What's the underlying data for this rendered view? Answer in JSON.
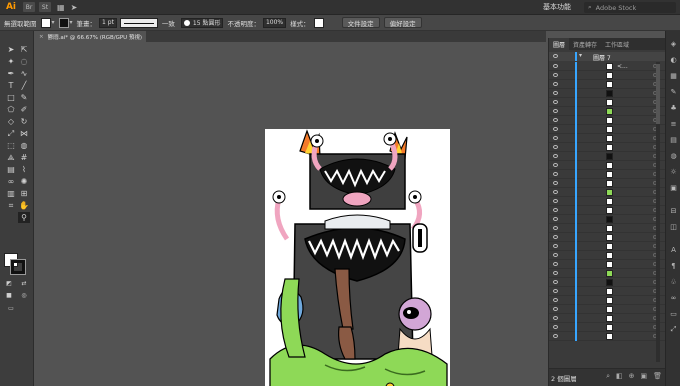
{
  "menubar": {
    "app_icon": "Ai",
    "bridge_chip": "Br",
    "stock_chip": "St",
    "workspace": "基本功能",
    "search_placeholder": "Adobe Stock"
  },
  "controlbar": {
    "selection_state": "無選取範圍",
    "stroke_label": "筆畫：",
    "stroke_weight": "1 pt",
    "stroke_style": "一致",
    "brush": "15 點圓形",
    "opacity_label": "不透明度：",
    "opacity_value": "100%",
    "style_label": "樣式：",
    "doc_setup": "文件設定",
    "preferences": "偏好設定"
  },
  "document_tab": {
    "title": "鬱悶.ai* @ 66.67% (RGB/GPU 預視)",
    "close": "×"
  },
  "layers_panel": {
    "tabs": [
      "圖層",
      "資產轉存",
      "工作區域"
    ],
    "active_tab": 0,
    "top_layer_name": "圖層 7",
    "sub_layer_name": "<...",
    "layer_count": "2 個圖層",
    "row_count": 31
  },
  "icons": {
    "tools": [
      "selection-icon",
      "direct-selection-icon",
      "magic-wand-icon",
      "lasso-icon",
      "pen-icon",
      "curvature-icon",
      "type-icon",
      "line-icon",
      "rectangle-icon",
      "paintbrush-icon",
      "shaper-icon",
      "pencil-icon",
      "eraser-icon",
      "rotate-icon",
      "scale-icon",
      "width-icon",
      "free-transform-icon",
      "shape-builder-icon",
      "perspective-grid-icon",
      "mesh-icon",
      "gradient-icon",
      "eyedropper-icon",
      "blend-icon",
      "symbol-sprayer-icon",
      "column-graph-icon",
      "artboard-icon",
      "slice-icon",
      "hand-icon",
      "zoom-icon"
    ]
  },
  "colors": {
    "ui_dark": "#323232",
    "ui_mid": "#474747",
    "canvas": "#535353",
    "layer_accent": "#38a6ff",
    "ai_brand": "#ff9a00"
  }
}
